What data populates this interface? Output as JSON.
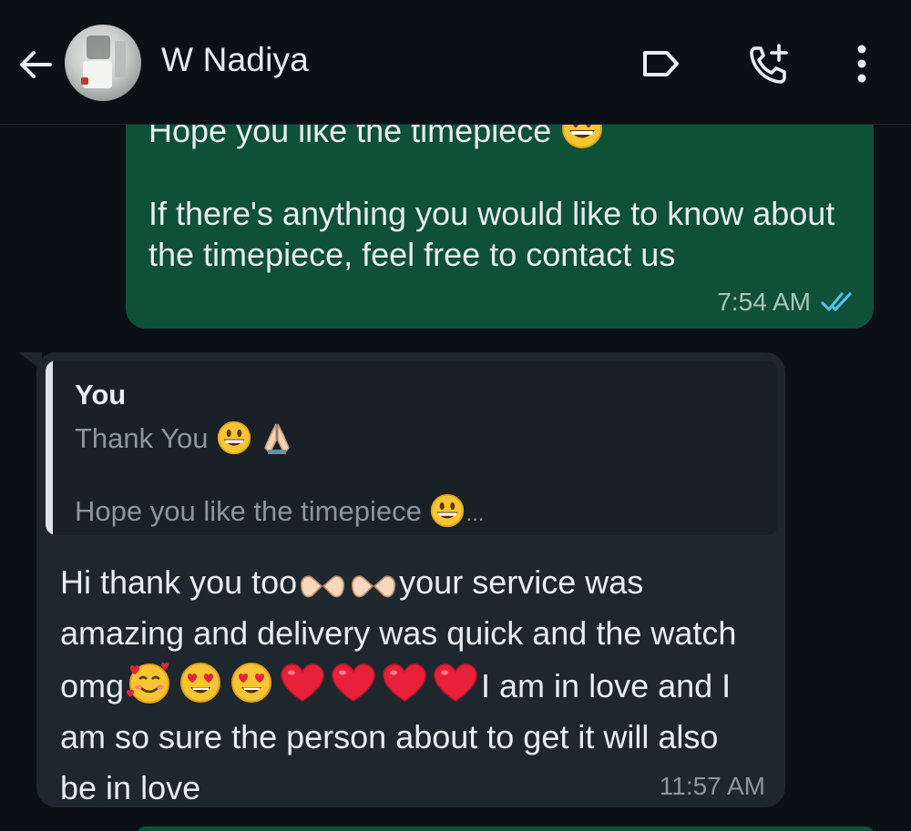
{
  "header": {
    "contact_name": "W Nadiya"
  },
  "outgoing_message": {
    "partial_first_line": "Hope you like the timepiece",
    "text": "If there's anything you would like to know about the timepiece, feel free to contact us",
    "time": "7:54 AM",
    "status": "read",
    "status_color": "#53bdeb"
  },
  "incoming_message": {
    "quote": {
      "author": "You",
      "line1": "Thank You",
      "line2": "Hope you like the timepiece",
      "line2_suffix": "..."
    },
    "text_part1": "Hi thank you too",
    "text_part2": "your service was amazing and delivery was quick and the watch omg",
    "text_part3": "I am in love and I am so sure the person about to get it will also be in love",
    "time": "11:57 AM"
  },
  "colors": {
    "background": "#0b1014",
    "outgoing_bubble": "#0f5039",
    "incoming_bubble": "#1e272d",
    "quote_bar": "#dfe3e5"
  },
  "icons": [
    "back-arrow-icon",
    "label-icon",
    "add-call-icon",
    "more-vert-icon",
    "grinning-face-emoji",
    "folded-hands-emoji",
    "heart-hands-emoji",
    "smiling-face-hearts-emoji",
    "heart-eyes-emoji",
    "red-heart-emoji"
  ]
}
